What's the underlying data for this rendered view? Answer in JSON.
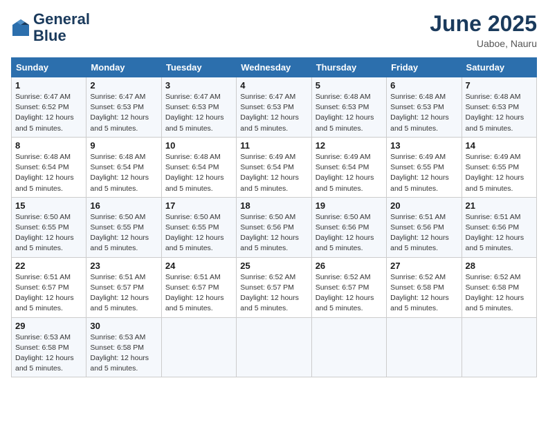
{
  "header": {
    "logo_line1": "General",
    "logo_line2": "Blue",
    "month_title": "June 2025",
    "location": "Uaboe, Nauru"
  },
  "weekdays": [
    "Sunday",
    "Monday",
    "Tuesday",
    "Wednesday",
    "Thursday",
    "Friday",
    "Saturday"
  ],
  "weeks": [
    [
      {
        "day": "1",
        "sunrise": "Sunrise: 6:47 AM",
        "sunset": "Sunset: 6:52 PM",
        "daylight": "Daylight: 12 hours and 5 minutes."
      },
      {
        "day": "2",
        "sunrise": "Sunrise: 6:47 AM",
        "sunset": "Sunset: 6:53 PM",
        "daylight": "Daylight: 12 hours and 5 minutes."
      },
      {
        "day": "3",
        "sunrise": "Sunrise: 6:47 AM",
        "sunset": "Sunset: 6:53 PM",
        "daylight": "Daylight: 12 hours and 5 minutes."
      },
      {
        "day": "4",
        "sunrise": "Sunrise: 6:47 AM",
        "sunset": "Sunset: 6:53 PM",
        "daylight": "Daylight: 12 hours and 5 minutes."
      },
      {
        "day": "5",
        "sunrise": "Sunrise: 6:48 AM",
        "sunset": "Sunset: 6:53 PM",
        "daylight": "Daylight: 12 hours and 5 minutes."
      },
      {
        "day": "6",
        "sunrise": "Sunrise: 6:48 AM",
        "sunset": "Sunset: 6:53 PM",
        "daylight": "Daylight: 12 hours and 5 minutes."
      },
      {
        "day": "7",
        "sunrise": "Sunrise: 6:48 AM",
        "sunset": "Sunset: 6:53 PM",
        "daylight": "Daylight: 12 hours and 5 minutes."
      }
    ],
    [
      {
        "day": "8",
        "sunrise": "Sunrise: 6:48 AM",
        "sunset": "Sunset: 6:54 PM",
        "daylight": "Daylight: 12 hours and 5 minutes."
      },
      {
        "day": "9",
        "sunrise": "Sunrise: 6:48 AM",
        "sunset": "Sunset: 6:54 PM",
        "daylight": "Daylight: 12 hours and 5 minutes."
      },
      {
        "day": "10",
        "sunrise": "Sunrise: 6:48 AM",
        "sunset": "Sunset: 6:54 PM",
        "daylight": "Daylight: 12 hours and 5 minutes."
      },
      {
        "day": "11",
        "sunrise": "Sunrise: 6:49 AM",
        "sunset": "Sunset: 6:54 PM",
        "daylight": "Daylight: 12 hours and 5 minutes."
      },
      {
        "day": "12",
        "sunrise": "Sunrise: 6:49 AM",
        "sunset": "Sunset: 6:54 PM",
        "daylight": "Daylight: 12 hours and 5 minutes."
      },
      {
        "day": "13",
        "sunrise": "Sunrise: 6:49 AM",
        "sunset": "Sunset: 6:55 PM",
        "daylight": "Daylight: 12 hours and 5 minutes."
      },
      {
        "day": "14",
        "sunrise": "Sunrise: 6:49 AM",
        "sunset": "Sunset: 6:55 PM",
        "daylight": "Daylight: 12 hours and 5 minutes."
      }
    ],
    [
      {
        "day": "15",
        "sunrise": "Sunrise: 6:50 AM",
        "sunset": "Sunset: 6:55 PM",
        "daylight": "Daylight: 12 hours and 5 minutes."
      },
      {
        "day": "16",
        "sunrise": "Sunrise: 6:50 AM",
        "sunset": "Sunset: 6:55 PM",
        "daylight": "Daylight: 12 hours and 5 minutes."
      },
      {
        "day": "17",
        "sunrise": "Sunrise: 6:50 AM",
        "sunset": "Sunset: 6:55 PM",
        "daylight": "Daylight: 12 hours and 5 minutes."
      },
      {
        "day": "18",
        "sunrise": "Sunrise: 6:50 AM",
        "sunset": "Sunset: 6:56 PM",
        "daylight": "Daylight: 12 hours and 5 minutes."
      },
      {
        "day": "19",
        "sunrise": "Sunrise: 6:50 AM",
        "sunset": "Sunset: 6:56 PM",
        "daylight": "Daylight: 12 hours and 5 minutes."
      },
      {
        "day": "20",
        "sunrise": "Sunrise: 6:51 AM",
        "sunset": "Sunset: 6:56 PM",
        "daylight": "Daylight: 12 hours and 5 minutes."
      },
      {
        "day": "21",
        "sunrise": "Sunrise: 6:51 AM",
        "sunset": "Sunset: 6:56 PM",
        "daylight": "Daylight: 12 hours and 5 minutes."
      }
    ],
    [
      {
        "day": "22",
        "sunrise": "Sunrise: 6:51 AM",
        "sunset": "Sunset: 6:57 PM",
        "daylight": "Daylight: 12 hours and 5 minutes."
      },
      {
        "day": "23",
        "sunrise": "Sunrise: 6:51 AM",
        "sunset": "Sunset: 6:57 PM",
        "daylight": "Daylight: 12 hours and 5 minutes."
      },
      {
        "day": "24",
        "sunrise": "Sunrise: 6:51 AM",
        "sunset": "Sunset: 6:57 PM",
        "daylight": "Daylight: 12 hours and 5 minutes."
      },
      {
        "day": "25",
        "sunrise": "Sunrise: 6:52 AM",
        "sunset": "Sunset: 6:57 PM",
        "daylight": "Daylight: 12 hours and 5 minutes."
      },
      {
        "day": "26",
        "sunrise": "Sunrise: 6:52 AM",
        "sunset": "Sunset: 6:57 PM",
        "daylight": "Daylight: 12 hours and 5 minutes."
      },
      {
        "day": "27",
        "sunrise": "Sunrise: 6:52 AM",
        "sunset": "Sunset: 6:58 PM",
        "daylight": "Daylight: 12 hours and 5 minutes."
      },
      {
        "day": "28",
        "sunrise": "Sunrise: 6:52 AM",
        "sunset": "Sunset: 6:58 PM",
        "daylight": "Daylight: 12 hours and 5 minutes."
      }
    ],
    [
      {
        "day": "29",
        "sunrise": "Sunrise: 6:53 AM",
        "sunset": "Sunset: 6:58 PM",
        "daylight": "Daylight: 12 hours and 5 minutes."
      },
      {
        "day": "30",
        "sunrise": "Sunrise: 6:53 AM",
        "sunset": "Sunset: 6:58 PM",
        "daylight": "Daylight: 12 hours and 5 minutes."
      },
      null,
      null,
      null,
      null,
      null
    ]
  ]
}
